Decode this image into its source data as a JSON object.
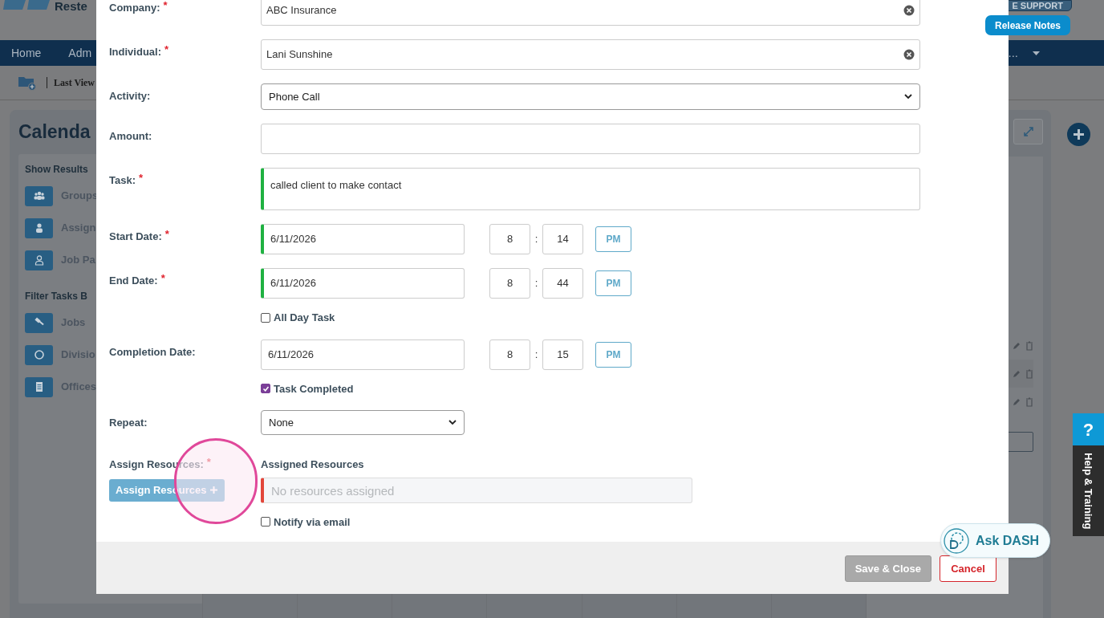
{
  "header": {
    "logo_text": "Reste",
    "support": "E SUPPORT",
    "release_notes": "Release Notes"
  },
  "nav": {
    "items": [
      "Home",
      "Adm"
    ],
    "more": "..."
  },
  "breadcrumb": {
    "label": "Last View"
  },
  "page": {
    "title": "Calenda"
  },
  "sidebar": {
    "sections": [
      {
        "title": "Show Results",
        "items": [
          {
            "label": "Groups",
            "kind": "users"
          },
          {
            "label": "Assign",
            "kind": "user"
          },
          {
            "label": "Job Pa",
            "kind": "user-outline"
          }
        ]
      },
      {
        "title": "Filter Tasks B",
        "items": [
          {
            "label": "Jobs",
            "kind": "gavel"
          },
          {
            "label": "Divisio",
            "kind": "circle"
          },
          {
            "label": "Offices",
            "kind": "doc"
          }
        ]
      }
    ]
  },
  "modal": {
    "fields": [
      {
        "kind": "text",
        "label": "Company:",
        "required_mark": "*",
        "value": "ABC Insurance",
        "clearable": true
      },
      {
        "kind": "text",
        "label": "Individual:",
        "required_mark": "*",
        "value": "Lani Sunshine",
        "clearable": true
      },
      {
        "kind": "select",
        "label": "Activity:",
        "value": "Phone Call"
      },
      {
        "kind": "text",
        "label": "Amount:"
      },
      {
        "kind": "textarea",
        "label": "Task:",
        "required_mark": "*",
        "value": "called client to make contact",
        "valid": true
      },
      {
        "kind": "datetime",
        "label": "Start Date:",
        "required_mark": "*",
        "value": "6/11/2026",
        "hour": "8",
        "separator": ":",
        "minute": "14",
        "ampm": "PM",
        "valid": true
      },
      {
        "kind": "datetime",
        "label": "End Date:",
        "required_mark": "*",
        "value": "6/11/2026",
        "hour": "8",
        "separator": ":",
        "minute": "44",
        "ampm": "PM",
        "valid": true,
        "checkbox": {
          "label": "All Day Task",
          "checked": false
        }
      },
      {
        "kind": "datetime",
        "label": "Completion Date:",
        "value": "6/11/2026",
        "hour": "8",
        "separator": ":",
        "minute": "15",
        "ampm": "PM",
        "valid": false,
        "checkbox": {
          "label": "Task Completed",
          "checked": true
        }
      },
      {
        "kind": "short_select",
        "label": "Repeat:",
        "value": "None"
      },
      {
        "kind": "resources",
        "label": "Assign Resources:",
        "required_mark": "*",
        "button": "Assign Resources",
        "heading": "Assigned Resources",
        "placeholder": "No resources assigned",
        "error": true,
        "checkbox": {
          "label": "Notify via email",
          "checked": false
        }
      }
    ],
    "buttons": [
      {
        "label": "Save & Close",
        "kind": "primary",
        "disabled": true
      },
      {
        "label": "Cancel",
        "kind": "cancel",
        "disabled": false
      }
    ]
  },
  "help": {
    "icon_text": "?",
    "label": "Help & Training"
  },
  "assistant": {
    "prefix": "Ask",
    "name": "DASH"
  }
}
